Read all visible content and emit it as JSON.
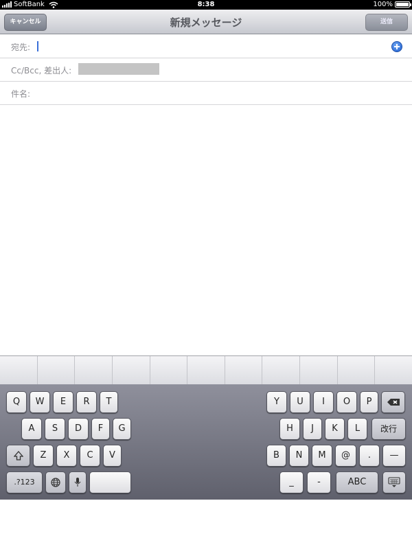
{
  "status_bar": {
    "carrier": "SoftBank",
    "time": "8:38",
    "battery_text": "100%",
    "battery_level": 1.0
  },
  "nav": {
    "cancel_label": "キャンセル",
    "title": "新規メッセージ",
    "send_label": "送信"
  },
  "fields": {
    "to_label": "宛先:",
    "ccbcc_label": "Cc/Bcc, 差出人:",
    "subject_label": "件名:"
  },
  "keyboard": {
    "row1_left": [
      "Q",
      "W",
      "E",
      "R",
      "T"
    ],
    "row1_right": [
      "Y",
      "U",
      "I",
      "O",
      "P"
    ],
    "row2_left": [
      "A",
      "S",
      "D",
      "F",
      "G"
    ],
    "row2_right": [
      "H",
      "J",
      "K",
      "L"
    ],
    "return_label": "改行",
    "row3_left": [
      "Z",
      "X",
      "C",
      "V"
    ],
    "row3_right": [
      "B",
      "N",
      "M",
      "@",
      ".",
      "—"
    ],
    "numbers_label": ".?123",
    "underscore_label": "_",
    "dash_label": "-",
    "abc_label": "ABC"
  }
}
